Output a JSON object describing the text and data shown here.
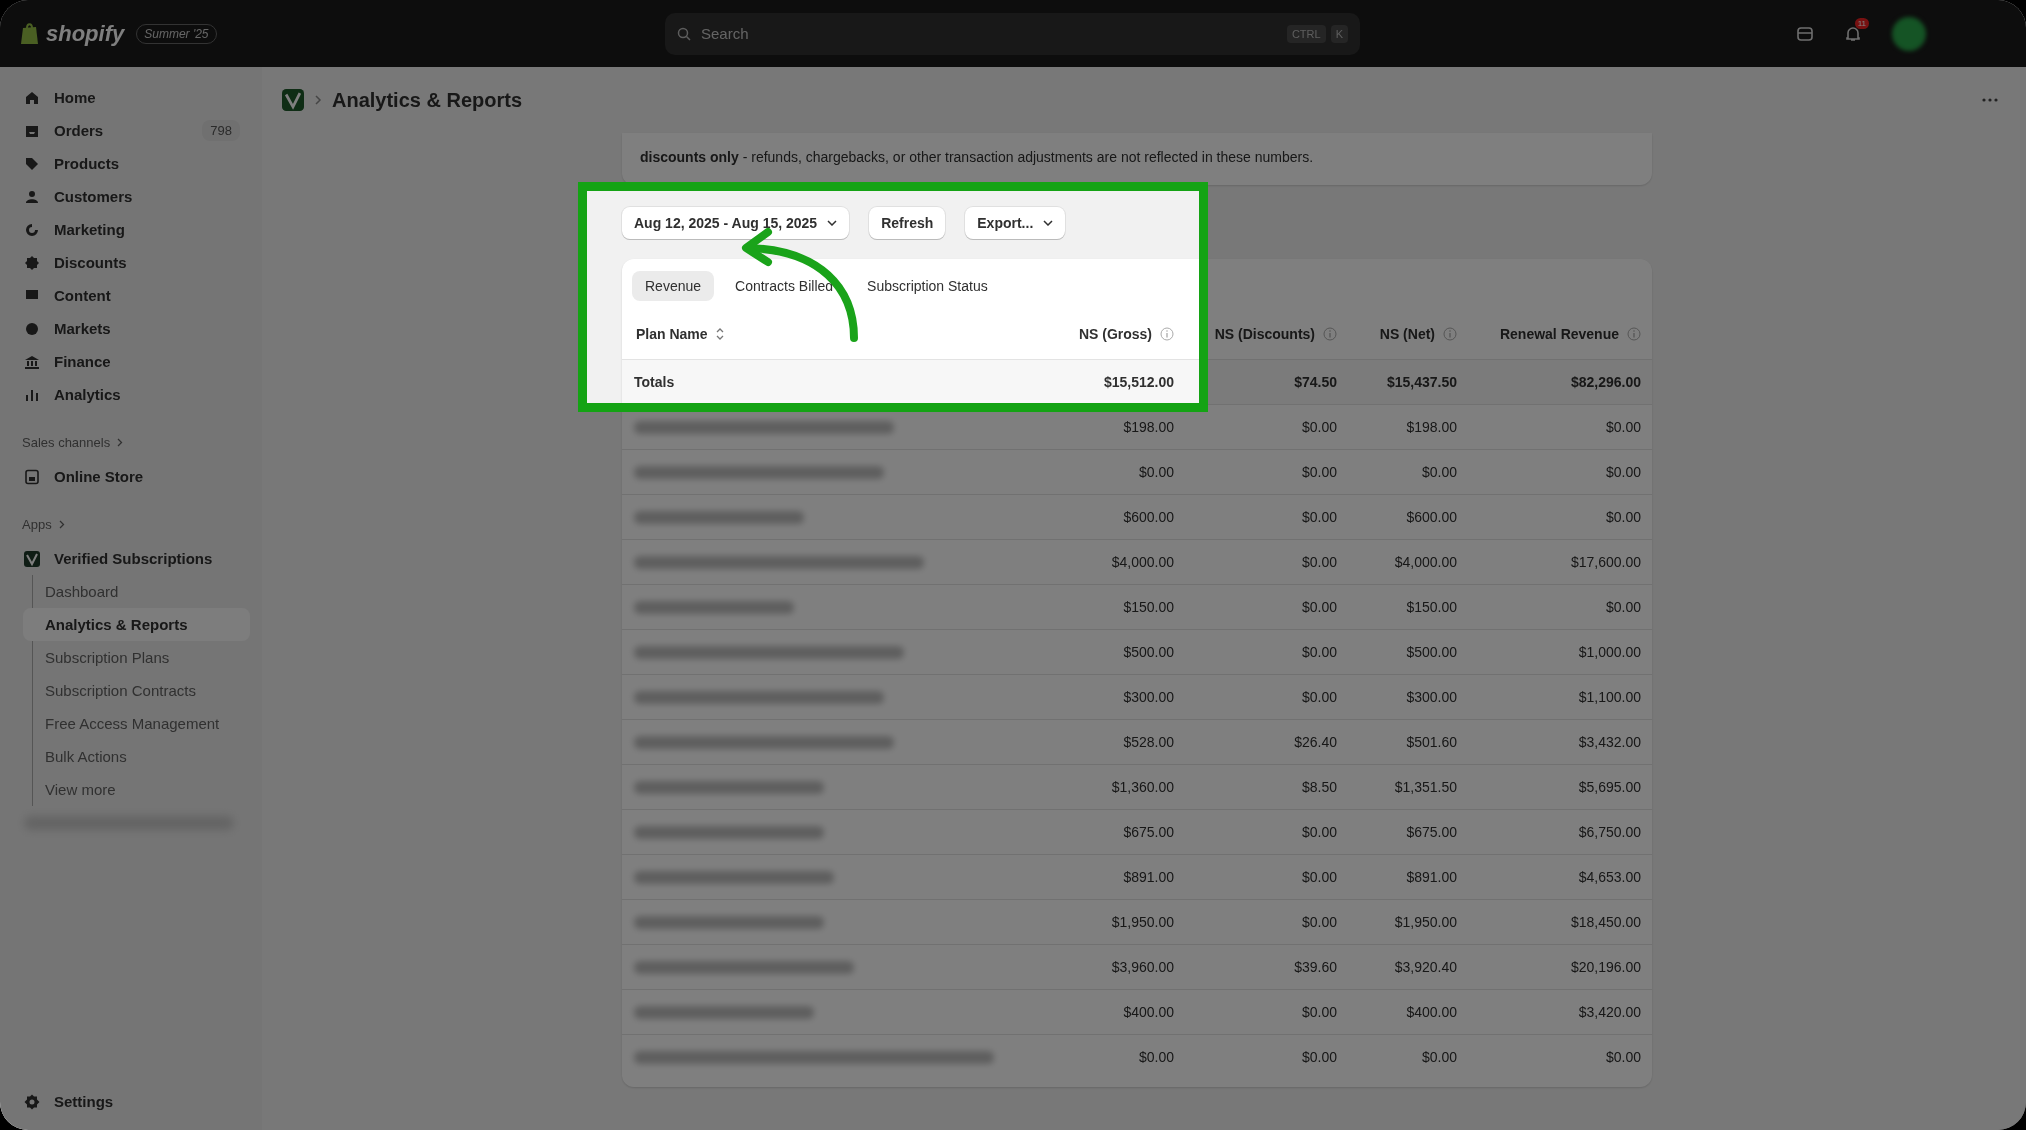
{
  "topbar": {
    "logo": "shopify",
    "edition": "Summer '25",
    "search": {
      "placeholder": "Search",
      "keys": [
        "CTRL",
        "K"
      ]
    },
    "notification_count": "11"
  },
  "sidebar": {
    "items": [
      {
        "label": "Home"
      },
      {
        "label": "Orders",
        "badge": "798"
      },
      {
        "label": "Products"
      },
      {
        "label": "Customers"
      },
      {
        "label": "Marketing"
      },
      {
        "label": "Discounts"
      },
      {
        "label": "Content"
      },
      {
        "label": "Markets"
      },
      {
        "label": "Finance"
      },
      {
        "label": "Analytics"
      }
    ],
    "sales_channels": {
      "heading": "Sales channels",
      "items": [
        {
          "label": "Online Store"
        }
      ]
    },
    "apps": {
      "heading": "Apps",
      "app": {
        "label": "Verified Subscriptions",
        "children": [
          {
            "label": "Dashboard",
            "selected": false
          },
          {
            "label": "Analytics & Reports",
            "selected": true
          },
          {
            "label": "Subscription Plans",
            "selected": false
          },
          {
            "label": "Subscription Contracts",
            "selected": false
          },
          {
            "label": "Free Access Management",
            "selected": false
          },
          {
            "label": "Bulk Actions",
            "selected": false
          },
          {
            "label": "View more",
            "selected": false
          }
        ]
      }
    },
    "settings": "Settings"
  },
  "page": {
    "title": "Analytics & Reports",
    "info_text": "**discounts only** - refunds, chargebacks, or other transaction adjustments are not reflected in these numbers.",
    "date_range": "Aug 12, 2025 - Aug 15, 2025",
    "refresh": "Refresh",
    "export": "Export...",
    "tabs": [
      {
        "label": "Revenue",
        "selected": true
      },
      {
        "label": "Contracts Billed",
        "selected": false
      },
      {
        "label": "Subscription Status",
        "selected": false
      }
    ],
    "table": {
      "columns": [
        {
          "label": "Plan Name",
          "sortable": true,
          "info": false
        },
        {
          "label": "NS (Gross)",
          "sortable": false,
          "info": true
        },
        {
          "label": "NS (Discounts)",
          "sortable": false,
          "info": true
        },
        {
          "label": "NS (Net)",
          "sortable": false,
          "info": true
        },
        {
          "label": "Renewal Revenue",
          "sortable": false,
          "info": true
        }
      ],
      "totals": {
        "label": "Totals",
        "values": [
          "$15,512.00",
          "$74.50",
          "$15,437.50",
          "$82,296.00"
        ]
      },
      "rows": [
        {
          "values": [
            "$198.00",
            "$0.00",
            "$198.00",
            "$0.00"
          ]
        },
        {
          "values": [
            "$0.00",
            "$0.00",
            "$0.00",
            "$0.00"
          ]
        },
        {
          "values": [
            "$600.00",
            "$0.00",
            "$600.00",
            "$0.00"
          ]
        },
        {
          "values": [
            "$4,000.00",
            "$0.00",
            "$4,000.00",
            "$17,600.00"
          ]
        },
        {
          "values": [
            "$150.00",
            "$0.00",
            "$150.00",
            "$0.00"
          ]
        },
        {
          "values": [
            "$500.00",
            "$0.00",
            "$500.00",
            "$1,000.00"
          ]
        },
        {
          "values": [
            "$300.00",
            "$0.00",
            "$300.00",
            "$1,100.00"
          ]
        },
        {
          "values": [
            "$528.00",
            "$26.40",
            "$501.60",
            "$3,432.00"
          ]
        },
        {
          "values": [
            "$1,360.00",
            "$8.50",
            "$1,351.50",
            "$5,695.00"
          ]
        },
        {
          "values": [
            "$675.00",
            "$0.00",
            "$675.00",
            "$6,750.00"
          ]
        },
        {
          "values": [
            "$891.00",
            "$0.00",
            "$891.00",
            "$4,653.00"
          ]
        },
        {
          "values": [
            "$1,950.00",
            "$0.00",
            "$1,950.00",
            "$18,450.00"
          ]
        },
        {
          "values": [
            "$3,960.00",
            "$39.60",
            "$3,920.40",
            "$20,196.00"
          ]
        },
        {
          "values": [
            "$400.00",
            "$0.00",
            "$400.00",
            "$3,420.00"
          ]
        },
        {
          "values": [
            "$0.00",
            "$0.00",
            "$0.00",
            "$0.00"
          ]
        }
      ]
    }
  }
}
